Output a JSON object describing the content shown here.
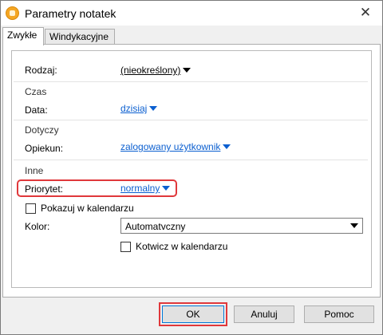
{
  "window": {
    "title": "Parametry notatek"
  },
  "tabs": [
    {
      "label": "Zwykłe",
      "active": true
    },
    {
      "label": "Windykacyjne",
      "active": false
    }
  ],
  "form": {
    "rodzaj": {
      "label": "Rodzaj:",
      "value": "(nieokreślony)"
    },
    "section_czas": "Czas",
    "data": {
      "label": "Data:",
      "value": "dzisiaj"
    },
    "section_dotyczy": "Dotyczy",
    "opiekun": {
      "label": "Opiekun:",
      "value": "zalogowany użytkownik"
    },
    "section_inne": "Inne",
    "priorytet": {
      "label": "Priorytet:",
      "value": "normalny"
    },
    "pokazuj": {
      "label": "Pokazuj w kalendarzu",
      "checked": false
    },
    "kolor": {
      "label": "Kolor:",
      "value": "Automatvczny"
    },
    "kotwicz": {
      "label": "Kotwicz w kalendarzu",
      "checked": false
    }
  },
  "buttons": {
    "ok": "OK",
    "cancel": "Anuluj",
    "help": "Pomoc"
  },
  "colors": {
    "link": "#0b5fd0",
    "highlight": "#e0383b",
    "focus": "#0078d7"
  },
  "icons": {
    "app": "notes-app-icon",
    "close": "close-icon"
  }
}
